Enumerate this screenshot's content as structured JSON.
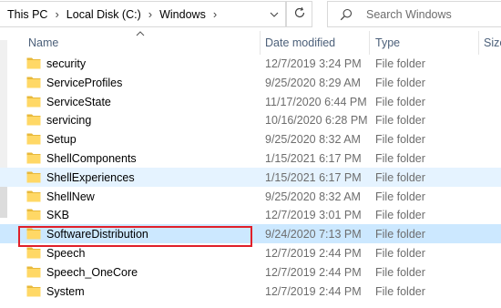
{
  "address_bar": {
    "crumbs": [
      "This PC",
      "Local Disk (C:)",
      "Windows"
    ],
    "separator": "›"
  },
  "search": {
    "placeholder": "Search Windows"
  },
  "columns": {
    "name": "Name",
    "date": "Date modified",
    "type": "Type",
    "size": "Size"
  },
  "rows": [
    {
      "name": "security",
      "date": "12/7/2019 3:24 PM",
      "type": "File folder"
    },
    {
      "name": "ServiceProfiles",
      "date": "9/25/2020 8:29 AM",
      "type": "File folder"
    },
    {
      "name": "ServiceState",
      "date": "11/17/2020 6:44 PM",
      "type": "File folder"
    },
    {
      "name": "servicing",
      "date": "10/16/2020 6:28 PM",
      "type": "File folder"
    },
    {
      "name": "Setup",
      "date": "9/25/2020 8:32 AM",
      "type": "File folder"
    },
    {
      "name": "ShellComponents",
      "date": "1/15/2021 6:17 PM",
      "type": "File folder"
    },
    {
      "name": "ShellExperiences",
      "date": "1/15/2021 6:17 PM",
      "type": "File folder"
    },
    {
      "name": "ShellNew",
      "date": "9/25/2020 8:32 AM",
      "type": "File folder"
    },
    {
      "name": "SKB",
      "date": "12/7/2019 3:01 PM",
      "type": "File folder"
    },
    {
      "name": "SoftwareDistribution",
      "date": "9/24/2020 7:13 PM",
      "type": "File folder"
    },
    {
      "name": "Speech",
      "date": "12/7/2019 2:44 PM",
      "type": "File folder"
    },
    {
      "name": "Speech_OneCore",
      "date": "12/7/2019 2:44 PM",
      "type": "File folder"
    },
    {
      "name": "System",
      "date": "12/7/2019 2:44 PM",
      "type": "File folder"
    }
  ],
  "hovered_row": "ShellExperiences",
  "selected_row": "SoftwareDistribution",
  "colors": {
    "selected_bg": "#cce8ff",
    "hover_bg": "#e5f3ff",
    "annotation_border": "#e0202a",
    "folder_yellow": "#ffd866"
  }
}
